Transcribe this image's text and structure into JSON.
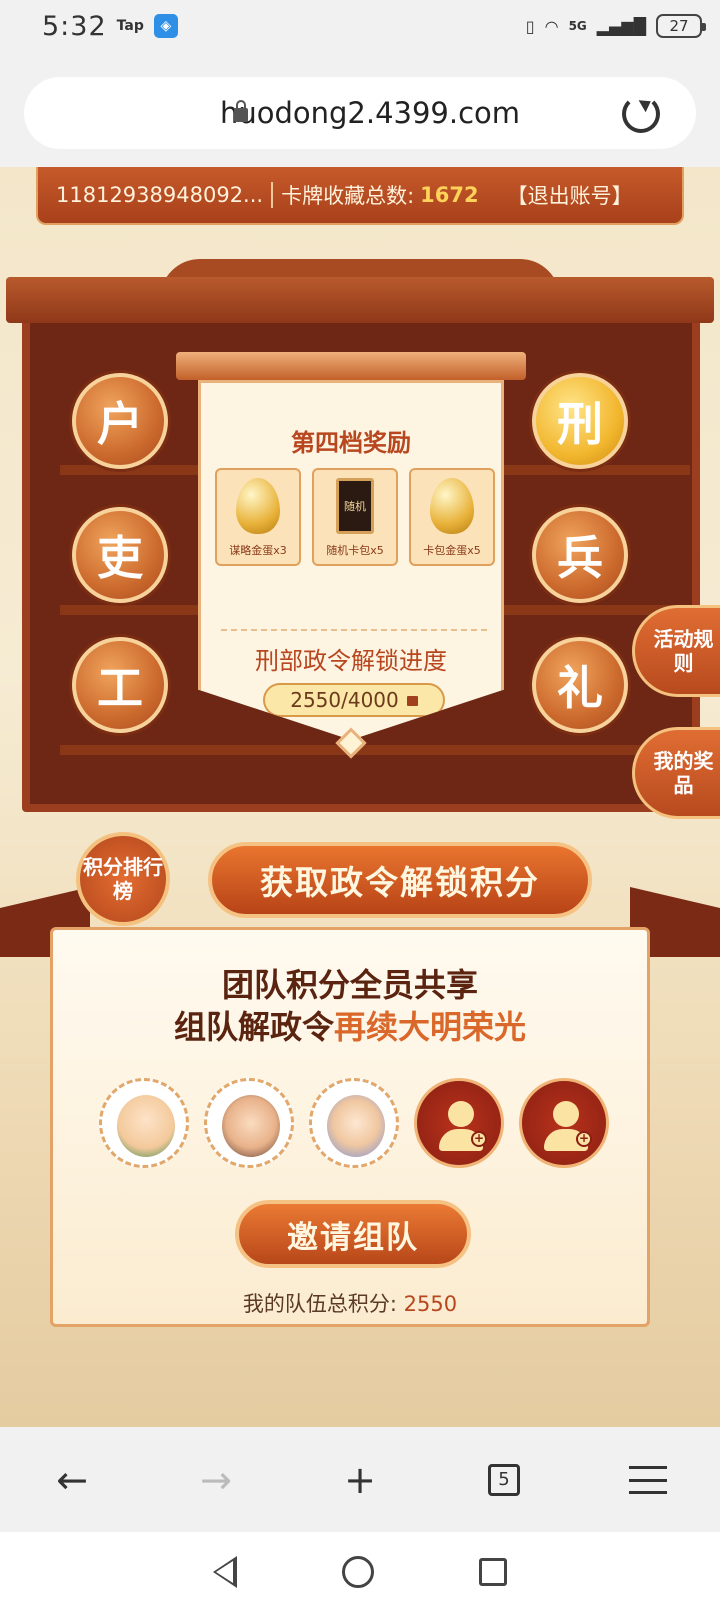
{
  "status_bar": {
    "time": "5:32",
    "tap_label": "Tap",
    "signal_label": "5G",
    "battery": "27"
  },
  "browser": {
    "url": "huodong2.4399.com"
  },
  "header": {
    "account_id": "11812938948092...",
    "collection_label": "卡牌收藏总数:",
    "collection_count": "1672",
    "logout_label": "【退出账号】"
  },
  "departments": {
    "left": [
      "户",
      "吏",
      "工"
    ],
    "right": [
      "刑",
      "兵",
      "礼"
    ]
  },
  "reward_panel": {
    "title": "第四档奖励",
    "items": [
      {
        "label": "谋略金蛋x3",
        "icon": "egg-icon"
      },
      {
        "label": "随机卡包x5",
        "icon": "card-pack-icon",
        "card_text": "随机"
      },
      {
        "label": "卡包金蛋x5",
        "icon": "egg-card-icon"
      }
    ],
    "progress_title": "刑部政令解锁进度",
    "progress_value": "2550/4000",
    "progress_fraction": 0.6375
  },
  "side_tabs": {
    "rules": "活动规则",
    "prizes": "我的奖品"
  },
  "rank_badge": "积分排行榜",
  "points_banner": "获取政令解锁积分",
  "team": {
    "slogan_line1": "团队积分全员共享",
    "slogan_line2_a": "组队解政令",
    "slogan_line2_b": "再续大明荣光",
    "invite_label": "邀请组队",
    "score_label": "我的队伍总积分:",
    "score_value": "2550"
  },
  "bottom_nav": {
    "tab_count": "5"
  },
  "colors": {
    "accent": "#c65a2a",
    "gold": "#ffd25a",
    "cabinet": "#6e2714"
  }
}
